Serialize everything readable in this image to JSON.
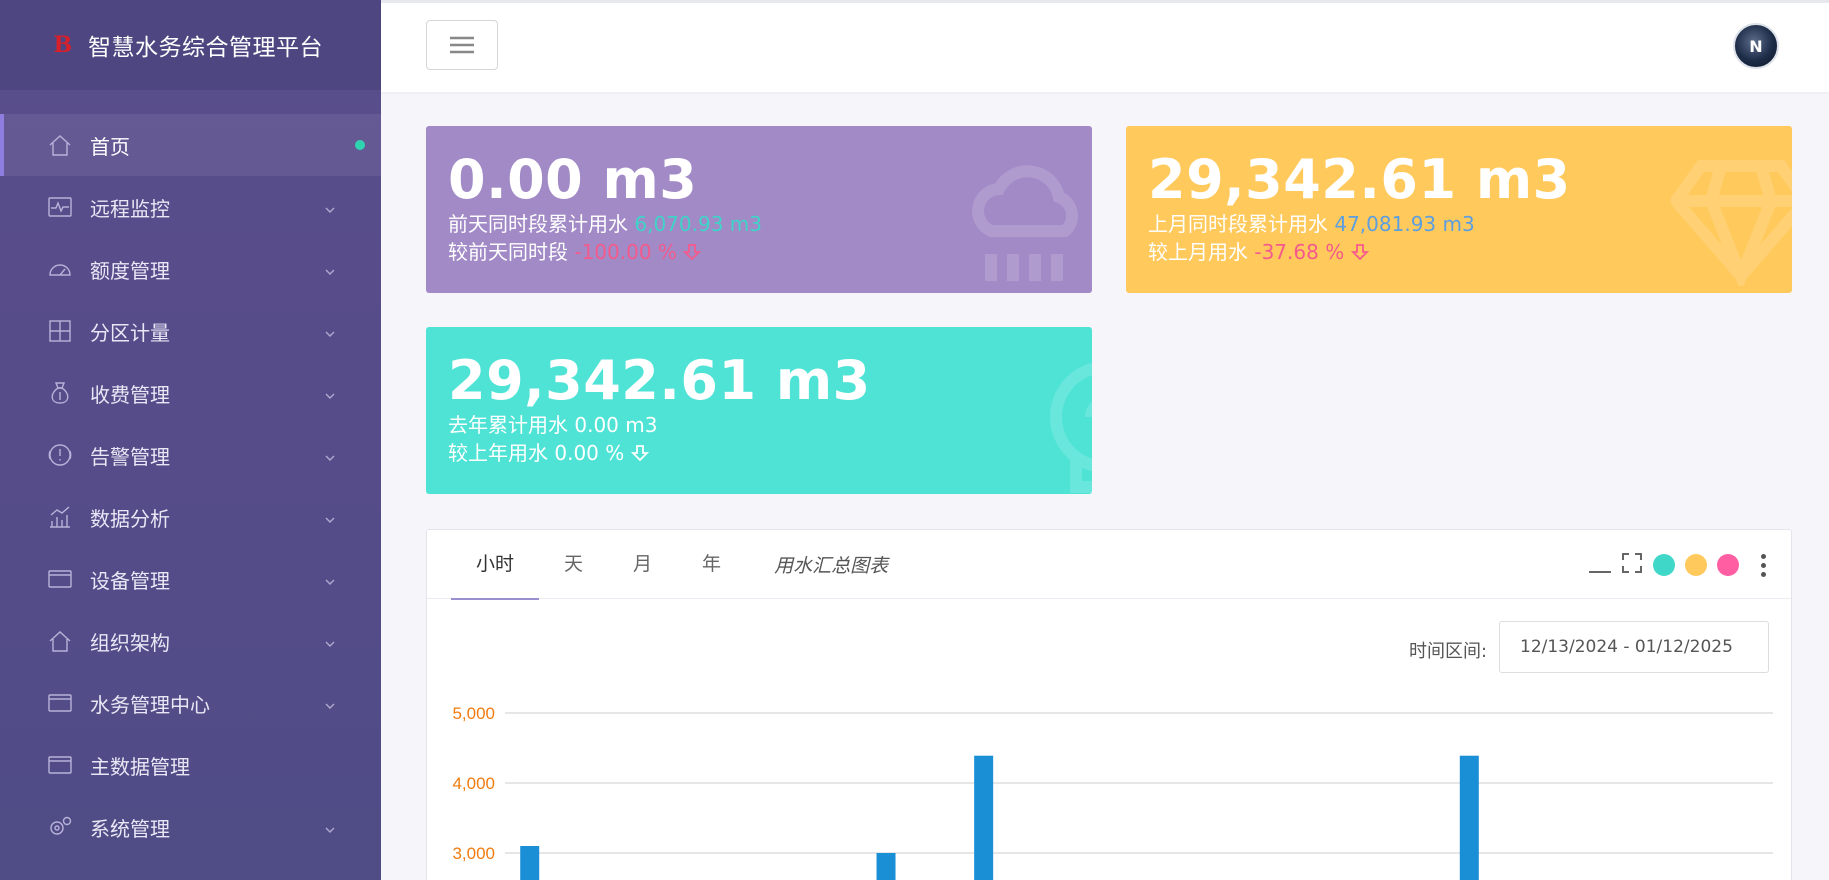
{
  "app": {
    "title": "智慧水务综合管理平台",
    "logo_text": "B"
  },
  "sidebar": {
    "items": [
      {
        "label": "首页",
        "icon": "home-icon",
        "active": true,
        "has_children": false
      },
      {
        "label": "远程监控",
        "icon": "monitor-pulse-icon",
        "has_children": true
      },
      {
        "label": "额度管理",
        "icon": "gauge-icon",
        "has_children": true
      },
      {
        "label": "分区计量",
        "icon": "grid-icon",
        "has_children": true
      },
      {
        "label": "收费管理",
        "icon": "money-bag-icon",
        "has_children": true
      },
      {
        "label": "告警管理",
        "icon": "alert-icon",
        "has_children": true
      },
      {
        "label": "数据分析",
        "icon": "bar-chart-icon",
        "has_children": true
      },
      {
        "label": "设备管理",
        "icon": "window-icon",
        "has_children": true
      },
      {
        "label": "组织架构",
        "icon": "home-icon",
        "has_children": true
      },
      {
        "label": "水务管理中心",
        "icon": "window-icon",
        "has_children": true
      },
      {
        "label": "主数据管理",
        "icon": "window-icon",
        "has_children": false
      },
      {
        "label": "系统管理",
        "icon": "gears-icon",
        "has_children": true
      }
    ]
  },
  "header": {
    "avatar_text": "N"
  },
  "cards": {
    "daily": {
      "value": "0.00 m3",
      "compare_label": "前天同时段累计用水",
      "compare_value": "6,070.93 m3",
      "change_label": "较前天同时段",
      "change_value": "-100.00 %",
      "color": "#a18ac6",
      "icon": "cloud-rain-icon"
    },
    "monthly": {
      "value": "29,342.61 m3",
      "compare_label": "上月同时段累计用水",
      "compare_value": "47,081.93 m3",
      "change_label": "较上月用水",
      "change_value": "-37.68 %",
      "color": "#ffc95c",
      "icon": "diamond-icon"
    },
    "yearly": {
      "value": "29,342.61 m3",
      "compare_text": "去年累计用水 0.00 m3",
      "change_text": "较上年用水 0.00 %",
      "color": "#4fe3d6",
      "icon": "lightbulb-icon"
    }
  },
  "panel": {
    "tabs": [
      "小时",
      "天",
      "月",
      "年"
    ],
    "active_tab": 0,
    "title": "用水汇总图表",
    "tool_colors": [
      "#3fd8c8",
      "#ffc95c",
      "#ff5fa2"
    ],
    "range_label": "时间区间:",
    "range_value": "12/13/2024 - 01/12/2025"
  },
  "chart_data": {
    "type": "bar",
    "y_ticks": [
      "5,000",
      "4,000",
      "3,000"
    ],
    "ylim": [
      2700,
      5000
    ],
    "bars": [
      {
        "x": 0.012,
        "value": 3100
      },
      {
        "x": 0.293,
        "value": 3000
      },
      {
        "x": 0.37,
        "value": 4390
      },
      {
        "x": 0.753,
        "value": 4390
      }
    ],
    "bar_color": "#1a8fd6"
  }
}
